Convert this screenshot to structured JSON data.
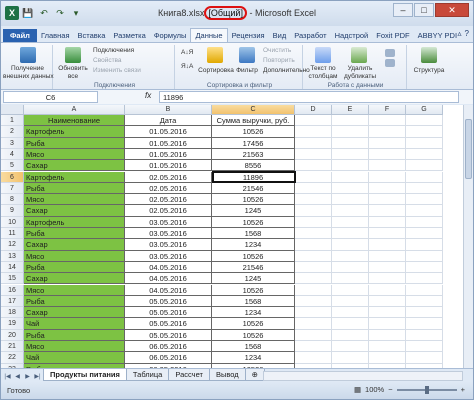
{
  "window": {
    "title_prefix": "Книга8.xlsx",
    "title_mode": "[Общий]",
    "title_suffix": " - Microsoft Excel",
    "minimize": "–",
    "maximize": "□",
    "close": "✕"
  },
  "qat": [
    "X",
    "💾",
    "↶",
    "↷",
    "▾"
  ],
  "ribbon_tabs": [
    "Файл",
    "Главная",
    "Вставка",
    "Разметка",
    "Формулы",
    "Данные",
    "Рецензия",
    "Вид",
    "Разработ",
    "Надстрой",
    "Foxit PDF",
    "ABBYY PDI"
  ],
  "active_tab_index": 5,
  "ribbon": {
    "get_data": "Получение\nвнешних данных",
    "refresh_all": "Обновить\nвсе",
    "connections": "Подключения",
    "properties": "Свойства",
    "edit_links": "Изменить связи",
    "group_connections": "Подключения",
    "sort_az": "А↓Я",
    "sort_za": "Я↓А",
    "sort": "Сортировка",
    "filter": "Фильтр",
    "clear": "Очистить",
    "reapply": "Повторить",
    "advanced": "Дополнительно",
    "group_sort": "Сортировка и фильтр",
    "text_to_columns": "Текст по\nстолбцам",
    "remove_duplicates": "Удалить\nдубликаты",
    "group_data_tools": "Работа с данными",
    "outline": "Структура"
  },
  "formula_bar": {
    "name_box": "C6",
    "fx": "fx",
    "value": "11896"
  },
  "columns": [
    "A",
    "B",
    "C",
    "D",
    "E",
    "F",
    "G"
  ],
  "headers": [
    "Наименование",
    "Дата",
    "Сумма выручки, руб."
  ],
  "rows": [
    [
      "Картофель",
      "01.05.2016",
      "10526"
    ],
    [
      "Рыба",
      "01.05.2016",
      "17456"
    ],
    [
      "Мясо",
      "01.05.2016",
      "21563"
    ],
    [
      "Сахар",
      "01.05.2016",
      "8556"
    ],
    [
      "Картофель",
      "02.05.2016",
      "11896"
    ],
    [
      "Рыба",
      "02.05.2016",
      "21546"
    ],
    [
      "Мясо",
      "02.05.2016",
      "10526"
    ],
    [
      "Сахар",
      "02.05.2016",
      "1245"
    ],
    [
      "Картофель",
      "03.05.2016",
      "10526"
    ],
    [
      "Рыба",
      "03.05.2016",
      "1568"
    ],
    [
      "Сахар",
      "03.05.2016",
      "1234"
    ],
    [
      "Мясо",
      "03.05.2016",
      "10526"
    ],
    [
      "Рыба",
      "04.05.2016",
      "21546"
    ],
    [
      "Сахар",
      "04.05.2016",
      "1245"
    ],
    [
      "Мясо",
      "04.05.2016",
      "10526"
    ],
    [
      "Рыба",
      "05.05.2016",
      "1568"
    ],
    [
      "Сахар",
      "05.05.2016",
      "1234"
    ],
    [
      "Чай",
      "05.05.2016",
      "10526"
    ],
    [
      "Рыба",
      "05.05.2016",
      "10526"
    ],
    [
      "Мясо",
      "06.05.2016",
      "1568"
    ],
    [
      "Чай",
      "06.05.2016",
      "1234"
    ],
    [
      "Рыба",
      "06.05.2016",
      "10526"
    ]
  ],
  "sheet_tabs": [
    "Продукты питания",
    "Таблица",
    "Рассчет",
    "Вывод"
  ],
  "active_sheet_index": 0,
  "status": {
    "ready": "Готово",
    "zoom": "100%"
  }
}
